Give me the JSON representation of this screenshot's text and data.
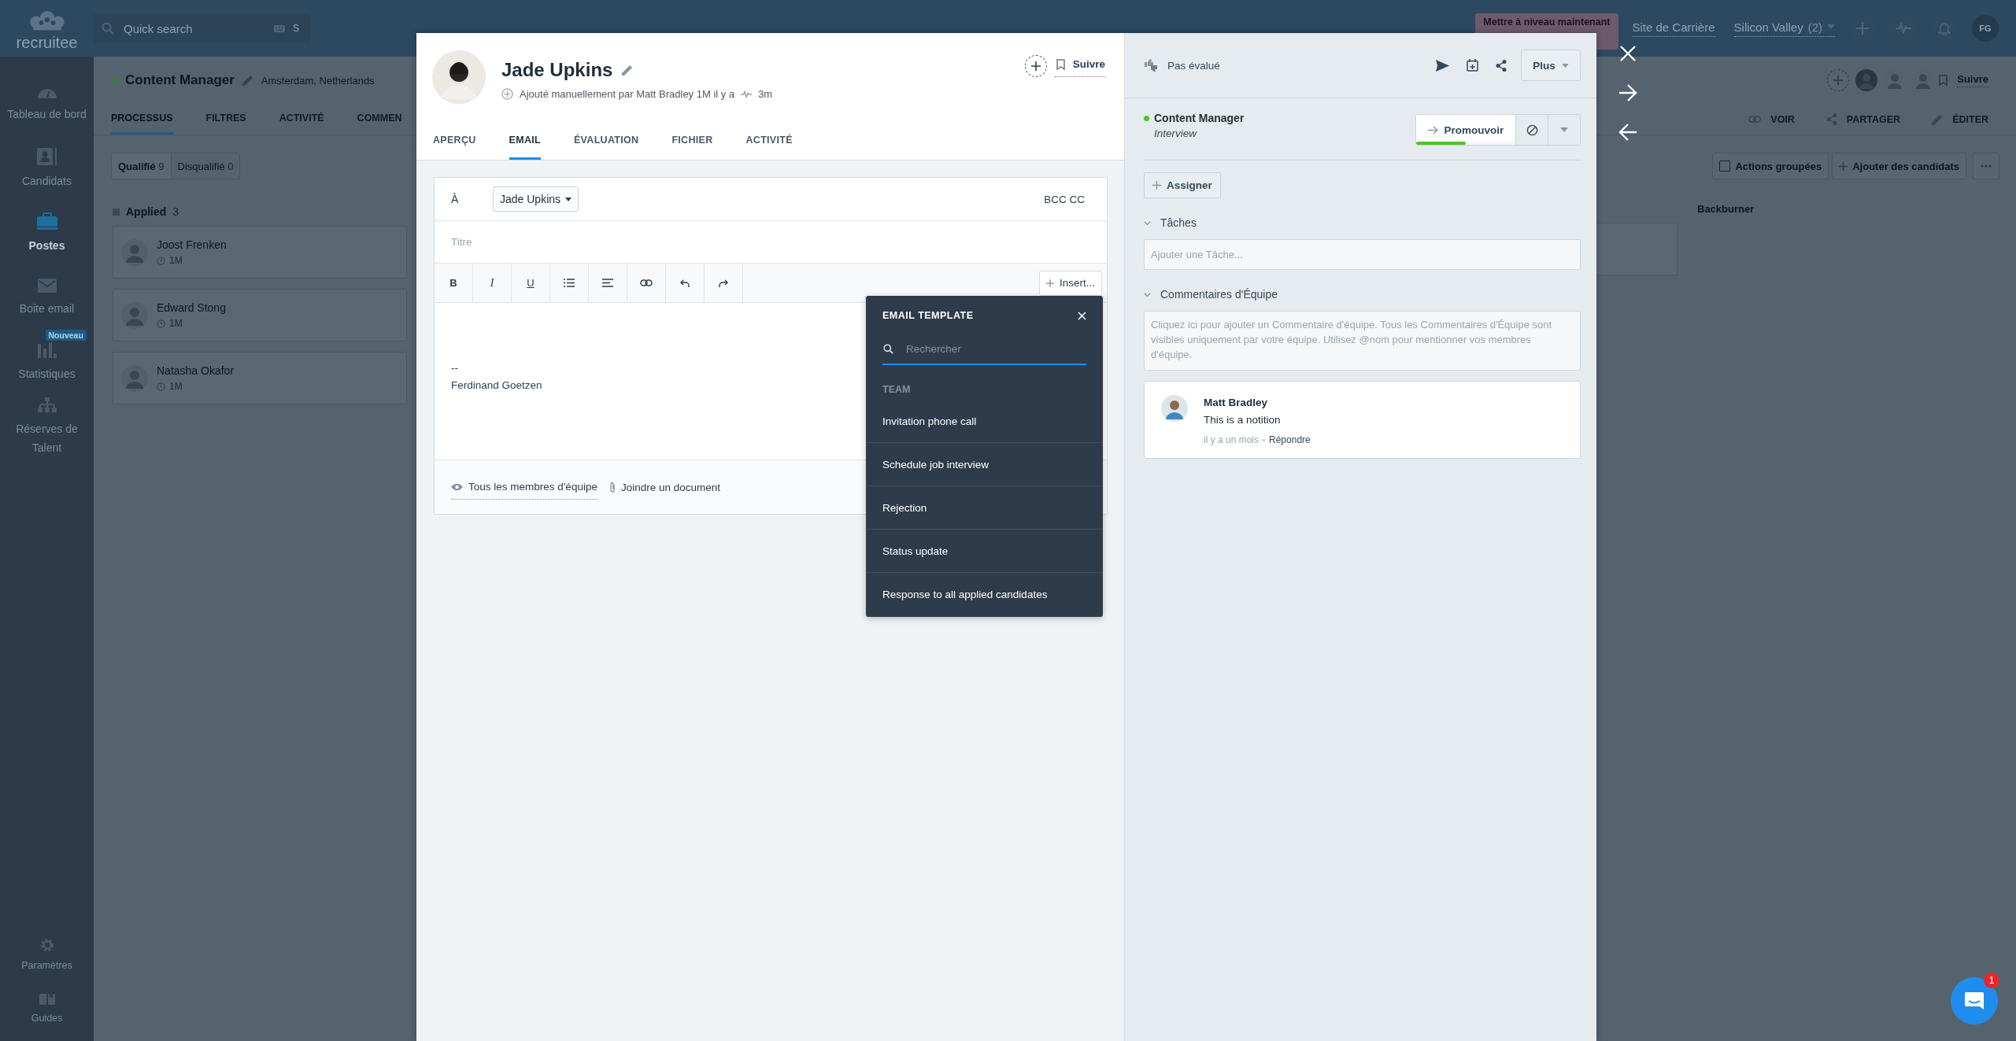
{
  "topbar": {
    "logo": "recruitee",
    "search": {
      "placeholder": "Quick search",
      "shortcut": "S"
    },
    "upgrade": "Mettre à niveau maintenant",
    "career_site": "Site de Carrière",
    "company": {
      "name": "Silicon Valley",
      "count": "(2)"
    },
    "user_initials": "FG"
  },
  "sidebar": {
    "items": [
      {
        "label": "Tableau de bord",
        "selected": false
      },
      {
        "label": "Candidats",
        "selected": false
      },
      {
        "label": "Postes",
        "selected": true
      },
      {
        "label": "Boite email",
        "selected": false
      },
      {
        "label": "Statistiques",
        "selected": false,
        "badge": "Nouveau"
      },
      {
        "label": "Réserves de Talent",
        "selected": false
      }
    ],
    "bottom_items": [
      {
        "label": "Paramètres",
        "selected": false
      },
      {
        "label": "Guides",
        "selected": false
      }
    ]
  },
  "job": {
    "title": "Content Manager",
    "location": "Amsterdam, Netherlands",
    "tabs": [
      {
        "label": "PROCESSUS",
        "selected": true
      },
      {
        "label": "FILTRES",
        "selected": false
      },
      {
        "label": "ACTIVITÉ",
        "selected": false
      },
      {
        "label": "COMMEN",
        "selected": false
      }
    ],
    "filters": [
      {
        "label": "Qualifié",
        "count": "9",
        "selected": true
      },
      {
        "label": "Disqualifié",
        "count": "0",
        "selected": false
      }
    ],
    "stage": {
      "name": "Applied",
      "count": "3"
    },
    "candidates": [
      {
        "name": "Joost Frenken",
        "age": "1M"
      },
      {
        "name": "Edward Stong",
        "age": "1M"
      },
      {
        "name": "Natasha Okafor",
        "age": "1M"
      }
    ],
    "follow": "Suivre",
    "bulk_checked": false,
    "links": [
      "VOIR",
      "PARTAGER",
      "ÉDITER"
    ],
    "bulk_actions": "Actions groupées",
    "add_candidates": "Ajouter des candidats",
    "next_stage": "Backburner"
  },
  "candidate": {
    "name": "Jade Upkins",
    "source": "Ajouté manuellement par Matt Bradley 1M il y a",
    "activity": "3m",
    "follow": "Suivre",
    "tabs": [
      {
        "label": "APERÇU",
        "selected": false
      },
      {
        "label": "EMAIL",
        "selected": true
      },
      {
        "label": "ÉVALUATION",
        "selected": false
      },
      {
        "label": "FICHIER",
        "selected": false
      },
      {
        "label": "ACTIVITÉ",
        "selected": false
      }
    ]
  },
  "email": {
    "to_label": "À",
    "recipient": "Jade Upkins",
    "bcc_cc": "BCC CC",
    "subject_placeholder": "Titre",
    "format_buttons": [
      "B",
      "I",
      "U"
    ],
    "insert": "Insert...",
    "body": [
      "--",
      "Ferdinand Goetzen"
    ],
    "visibility": "Tous les membres d'équipe",
    "attach": "Joindre un document"
  },
  "template_menu": {
    "title": "EMAIL TEMPLATE",
    "search_placeholder": "Rechercher",
    "group": "TEAM",
    "items": [
      "Invitation phone call",
      "Schedule job interview",
      "Rejection",
      "Status update",
      "Response to all applied candidates"
    ]
  },
  "side_panel": {
    "rating": "Pas évalué",
    "more": "Plus",
    "job": "Content Manager",
    "stage": "Interview",
    "promote": {
      "label": "Promouvoir",
      "level": 0.5
    },
    "assign": "Assigner",
    "tasks": {
      "title": "Tâches",
      "expanded": true,
      "placeholder": "Ajouter une Tâche..."
    },
    "comments": {
      "title": "Commentaires d'Équipe",
      "expanded": true,
      "placeholder": "Cliquez ici pour ajouter un Commentaire d'équipe. Tous les Commentaires d'Équipe sont visibles uniquement par votre équipe. Utilisez @nom pour mentionner vos membres d'équipe.",
      "items": [
        {
          "author": "Matt Bradley",
          "text": "This is a notition",
          "time": "il y a un mois",
          "reply": "Répondre"
        }
      ]
    }
  },
  "chat": {
    "unread": "1"
  }
}
